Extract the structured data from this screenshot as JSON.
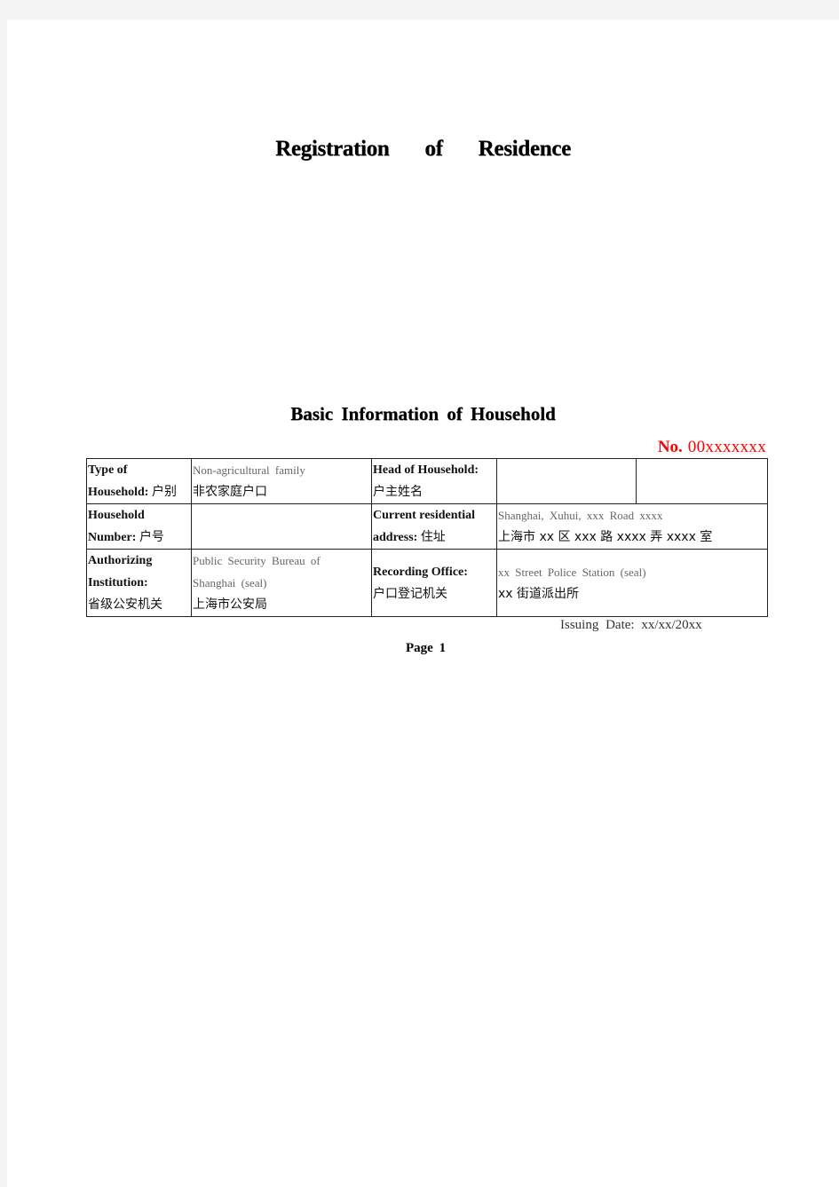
{
  "document": {
    "title_words": [
      "Registration",
      "of",
      "Residence"
    ],
    "subtitle": "Basic Information of Household",
    "number_label": "No.",
    "number_value": "00xxxxxxx",
    "issuing_date": "Issuing Date: xx/xx/20xx",
    "page_label": "Page 1"
  },
  "table": {
    "rows": [
      {
        "left_label_en_1": "Type of",
        "left_label_en_2": "Household:",
        "left_label_cn": "户别",
        "left_value_en": "Non-agricultural family",
        "left_value_cn": "非农家庭户口",
        "right_label_en": "Head of Household:",
        "right_label_cn": "户主姓名",
        "right_value_1": "",
        "right_value_2": ""
      },
      {
        "left_label_en_1": "Household",
        "left_label_en_2": "Number:",
        "left_label_cn": "户号",
        "left_value": "",
        "right_label_en_1": "Current residential",
        "right_label_en_2": "address:",
        "right_label_cn": "住址",
        "right_value_en": "Shanghai, Xuhui, xxx Road xxxx",
        "right_value_cn": "上海市 xx 区 xxx 路 xxxx 弄 xxxx 室"
      },
      {
        "left_label_en_1": "Authorizing",
        "left_label_en_2": "Institution:",
        "left_label_cn": "省级公安机关",
        "left_value_en_1": "Public Security Bureau of",
        "left_value_en_2": "Shanghai (seal)",
        "left_value_cn": "上海市公安局",
        "right_label_en": "Recording Office:",
        "right_label_cn": "户口登记机关",
        "right_value_en": "xx Street Police Station (seal)",
        "right_value_cn": "xx 街道派出所"
      }
    ]
  },
  "colors": {
    "number_red": "#ff0000",
    "background": "#f3f3f3",
    "page": "#ffffff"
  }
}
